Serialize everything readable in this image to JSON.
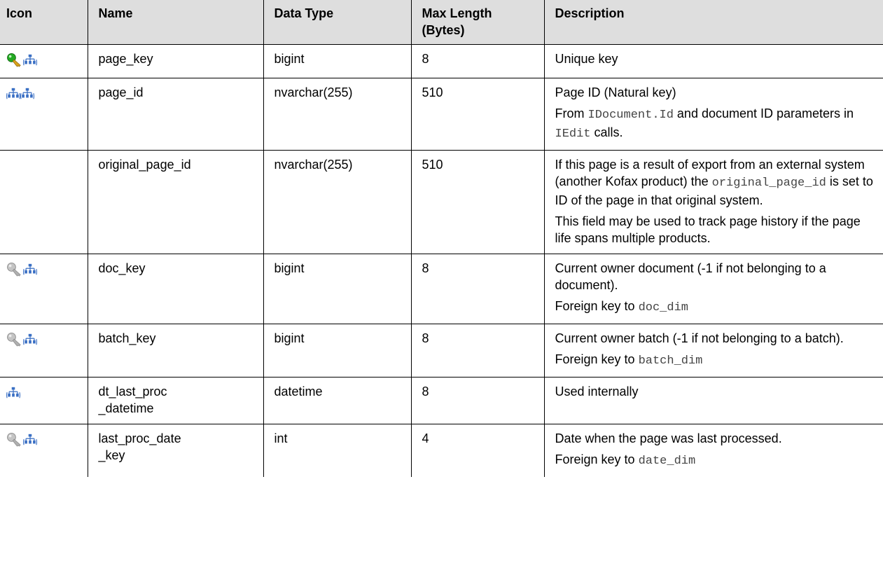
{
  "headers": {
    "icon": "Icon",
    "name": "Name",
    "data_type": "Data Type",
    "max_length_1": "Max Length",
    "max_length_2": "(Bytes)",
    "description": "Description"
  },
  "rows": [
    {
      "icons": [
        "primary-key-icon",
        "index-icon"
      ],
      "name": "page_key",
      "data_type": "bigint",
      "max_length": "8",
      "desc": [
        {
          "text": "Unique key"
        }
      ]
    },
    {
      "icons": [
        "index-icon",
        "index-icon"
      ],
      "name": "page_id",
      "data_type": "nvarchar(255)",
      "max_length": "510",
      "desc_p1": "Page ID (Natural key)",
      "desc_p2_a": "From ",
      "desc_p2_code1": "IDocument.Id",
      "desc_p2_b": " and document ID parameters in ",
      "desc_p2_code2": "IEdit",
      "desc_p2_c": " calls."
    },
    {
      "icons": [],
      "name": "original_page_id",
      "data_type": "nvarchar(255)",
      "max_length": "510",
      "desc_p1_a": "If this page is a result of export from an external system (another Kofax product) the ",
      "desc_p1_code": "original_page_id",
      "desc_p1_b": " is set to ID of the page in that original system.",
      "desc_p2": "This field may be used to track page history if the page life spans multiple products."
    },
    {
      "icons": [
        "foreign-key-icon",
        "index-icon"
      ],
      "name": "doc_key",
      "data_type": "bigint",
      "max_length": "8",
      "desc_p1": "Current owner document (-1 if not belonging to a document).",
      "desc_p2_a": "Foreign key to ",
      "desc_p2_code": "doc_dim"
    },
    {
      "icons": [
        "foreign-key-icon",
        "index-icon"
      ],
      "name": "batch_key",
      "data_type": "bigint",
      "max_length": "8",
      "desc_p1": "Current owner batch (-1 if not belonging to a batch).",
      "desc_p2_a": "Foreign key to ",
      "desc_p2_code": "batch_dim"
    },
    {
      "icons": [
        "index-icon"
      ],
      "name": "dt_last_proc_datetime",
      "name_line1": "dt_last_proc",
      "name_line2": "_datetime",
      "data_type": "datetime",
      "max_length": "8",
      "desc_p1": "Used internally"
    },
    {
      "icons": [
        "foreign-key-icon",
        "index-icon"
      ],
      "name_line1": "last_proc_date",
      "name_line2": "_key",
      "data_type": "int",
      "max_length": "4",
      "desc_p1": "Date when the page was last processed.",
      "desc_p2_a": "Foreign key to ",
      "desc_p2_code": "date_dim"
    }
  ],
  "colors": {
    "header_bg": "#dedede",
    "border": "#000000",
    "primary_key_icon": "#22aa22",
    "foreign_key_icon": "#b8b8b8",
    "index_icon": "#3a6fc4",
    "code_text": "#444444"
  }
}
